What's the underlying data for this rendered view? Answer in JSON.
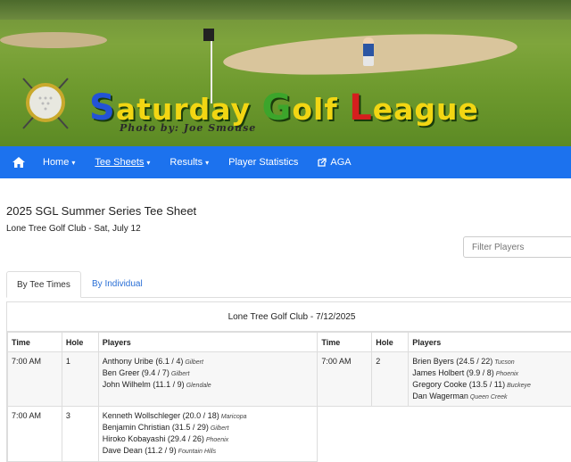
{
  "banner": {
    "title_parts": [
      {
        "text": "S",
        "color": "blue",
        "cap": true
      },
      {
        "text": "aturday ",
        "color": "yellow",
        "cap": false
      },
      {
        "text": "G",
        "color": "green",
        "cap": true
      },
      {
        "text": "olf ",
        "color": "yellow",
        "cap": false
      },
      {
        "text": "L",
        "color": "red",
        "cap": true
      },
      {
        "text": "eague",
        "color": "yellow",
        "cap": false
      }
    ],
    "photo_credit": "Photo by: Joe Smouse"
  },
  "nav": {
    "home_icon": "home-icon",
    "items": [
      {
        "label": "Home",
        "caret": "▾"
      },
      {
        "label": "Tee Sheets",
        "caret": "▾",
        "active": true
      },
      {
        "label": "Results",
        "caret": "▾"
      },
      {
        "label": "Player Statistics"
      },
      {
        "label": "AGA",
        "icon": "external-link-icon"
      }
    ]
  },
  "page": {
    "title": "2025 SGL Summer Series Tee Sheet",
    "subtitle": "Lone Tree Golf Club - Sat, July 12"
  },
  "filter": {
    "placeholder": "Filter Players"
  },
  "tabs": [
    {
      "label": "By Tee Times",
      "active": true
    },
    {
      "label": "By Individual",
      "active": false
    }
  ],
  "course_heading": "Lone Tree Golf Club - 7/12/2025",
  "table": {
    "headers": [
      "Time",
      "Hole",
      "Players",
      "Time",
      "Hole",
      "Players"
    ],
    "groups": [
      {
        "time": "7:00 AM",
        "hole": "1",
        "players": [
          {
            "name": "Anthony Uribe (6.1 / 4)",
            "city": "Gilbert"
          },
          {
            "name": "Ben Greer (9.4 / 7)",
            "city": "Gilbert"
          },
          {
            "name": "John Wilhelm (11.1 / 9)",
            "city": "Glendale"
          }
        ]
      },
      {
        "time": "7:00 AM",
        "hole": "2",
        "players": [
          {
            "name": "Brien Byers (24.5 / 22)",
            "city": "Tucson"
          },
          {
            "name": "James Holbert (9.9 / 8)",
            "city": "Phoenix"
          },
          {
            "name": "Gregory Cooke (13.5 / 11)",
            "city": "Buckeye"
          },
          {
            "name": "Dan Wagerman",
            "city": "Queen Creek"
          }
        ]
      },
      {
        "time": "7:00 AM",
        "hole": "3",
        "players": [
          {
            "name": "Kenneth Wollschleger (20.0 / 18)",
            "city": "Maricopa"
          },
          {
            "name": "Benjamin Christian (31.5 / 29)",
            "city": "Gilbert"
          },
          {
            "name": "Hiroko Kobayashi (29.4 / 26)",
            "city": "Phoenix"
          },
          {
            "name": "Dave Dean (11.2 / 9)",
            "city": "Fountain Hills"
          }
        ]
      }
    ]
  }
}
